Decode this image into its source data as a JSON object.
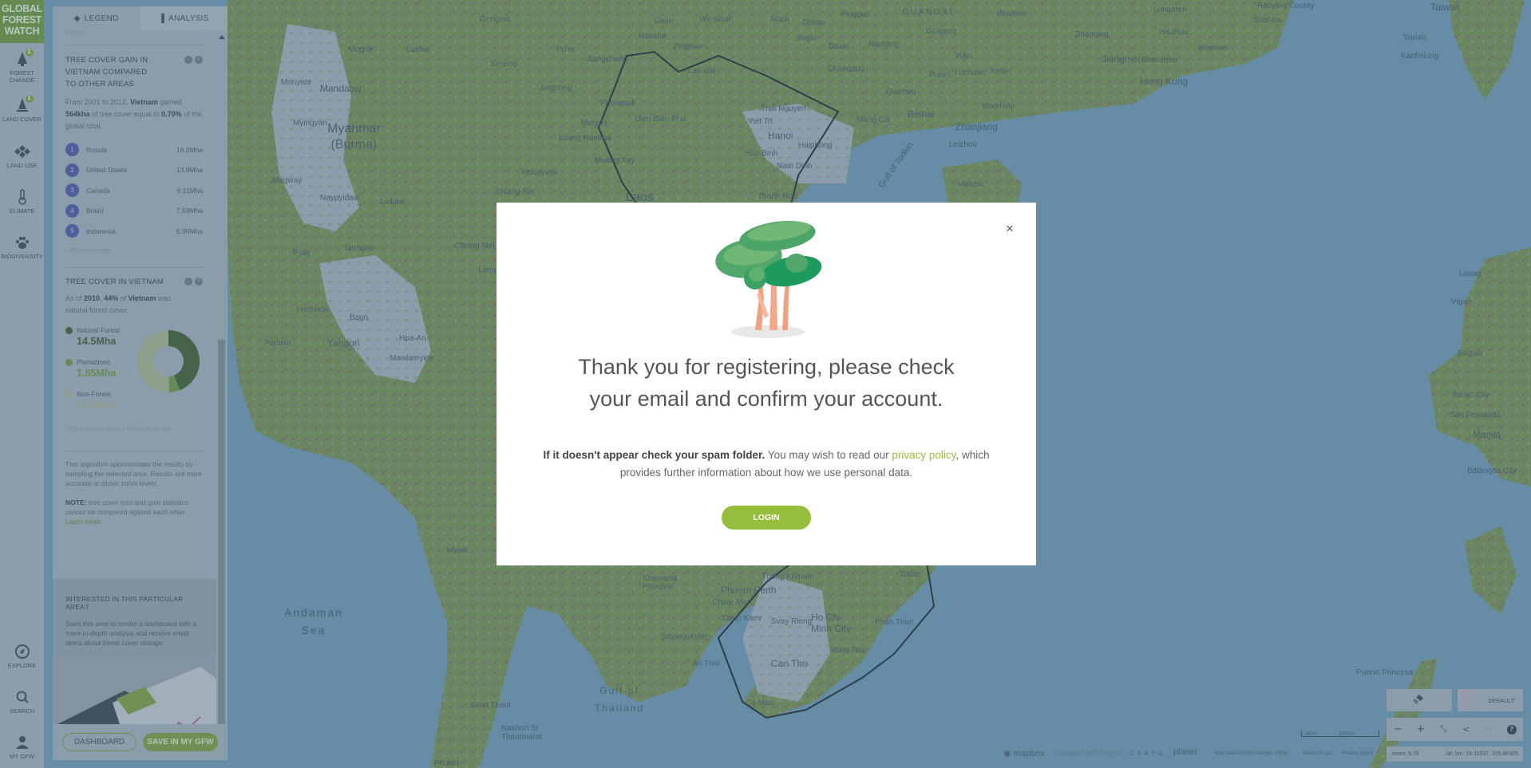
{
  "app": {
    "logo_lines": [
      "GLOBAL",
      "FOREST",
      "WATCH"
    ],
    "brand_color": "#6d9a3c",
    "accent_color": "#97bd3d"
  },
  "nav": {
    "items": [
      {
        "label": "FOREST\nCHANGE",
        "icon": "tree-icon",
        "badge": "2"
      },
      {
        "label": "LAND COVER",
        "icon": "pine-tree-icon",
        "badge": "1"
      },
      {
        "label": "LAND USE",
        "icon": "diamond-grid-icon"
      },
      {
        "label": "CLIMATE",
        "icon": "thermometer-icon"
      },
      {
        "label": "BIODIVERSITY",
        "icon": "paw-icon"
      }
    ],
    "bottom_items": [
      {
        "label": "EXPLORE",
        "icon": "compass-icon"
      },
      {
        "label": "SEARCH",
        "icon": "search-icon"
      },
      {
        "label": "MY GFW",
        "icon": "user-icon"
      }
    ]
  },
  "panel": {
    "tabs": [
      {
        "label": "LEGEND",
        "icon": "layers-icon",
        "active": false
      },
      {
        "label": "ANALYSIS",
        "icon": "bar-chart-icon",
        "active": true
      }
    ],
    "cut_text": "account",
    "gain_widget": {
      "title": "TREE COVER GAIN IN VIETNAM COMPARED TO OTHER AREAS",
      "sentence_prefix": "From 2001 to 2012, ",
      "country": "Vietnam",
      "sentence_mid": " gained ",
      "amount": "564kha",
      "sentence_mid2": " of tree cover equal to ",
      "percent": "0.70%",
      "sentence_suffix": " of the global total.",
      "ranking": [
        {
          "rank": "1",
          "name": "Russia",
          "value": "16.2Mha"
        },
        {
          "rank": "2",
          "name": "United States",
          "value": "13.8Mha"
        },
        {
          "rank": "3",
          "name": "Canada",
          "value": "9.11Mha"
        },
        {
          "rank": "4",
          "name": "Brazil",
          "value": "7.59Mha"
        },
        {
          "rank": "5",
          "name": "Indonesia",
          "value": "6.96Mha"
        }
      ],
      "note": ">50% tree canopy"
    },
    "cover_widget": {
      "title": "TREE COVER IN VIETNAM",
      "sentence_prefix": "As of ",
      "year": "2010",
      "sentence_comma": ", ",
      "percent": "44%",
      "sentence_of": " of ",
      "country": "Vietnam",
      "sentence_suffix": " was natural forest cover.",
      "legend": [
        {
          "name": "Natural Forest",
          "value": "14.5Mha",
          "color": "#3e5f2e"
        },
        {
          "name": "Plantations",
          "value": "1.85Mha",
          "color": "#6f9a45"
        },
        {
          "name": "Non-Forest",
          "value": "16.6Mha",
          "color": "#a9b58e"
        }
      ],
      "note": "2010 tree cover extent | >30% tree canopy"
    },
    "disclaimer": "This algorithm approximates the results by sampling the selected area. Results are more accurate at closer zoom levels.",
    "note_label": "NOTE:",
    "note_text": " tree cover loss and gain statistics cannot be compared against each other. ",
    "learn_more": "Learn more.",
    "cta": {
      "title": "INTERESTED IN THIS PARTICULAR AREA?",
      "text": "Save this area to create a dashboard with a more in-depth analysis and receive email alerts about forest cover change."
    },
    "buttons": {
      "dashboard": "DASHBOARD",
      "save": "SAVE IN MY GFW"
    }
  },
  "chart_data": {
    "type": "pie",
    "title": "TREE COVER IN VIETNAM",
    "categories": [
      "Natural Forest",
      "Plantations",
      "Non-Forest"
    ],
    "values": [
      14.5,
      1.85,
      16.6
    ],
    "unit": "Mha",
    "colors": [
      "#3e5f2e",
      "#6f9a45",
      "#a9b58e"
    ],
    "donut": true
  },
  "modal": {
    "title_line1": "Thank you for registering, please check",
    "title_line2": "your email and confirm your account.",
    "body_bold": "If it doesn't appear check your spam folder.",
    "body_text1": " You may wish to read our ",
    "privacy_link": "privacy policy",
    "body_text2": ", which provides further information about how we use personal data.",
    "login_button": "LOGIN",
    "close_icon": "close-icon"
  },
  "map": {
    "basemap_label": "DEFAULT",
    "zoom_readout": "zoom: 5.76",
    "latlon_readout": "lat, lon: 16.11537, 105.80305",
    "scale_labels": [
      "50mi",
      "100km"
    ],
    "attributions": [
      "mapbox",
      "Google Earth Engine",
      "CARTO",
      "planet",
      "Map data ©2018 Google, INEGI",
      "Terms of use",
      "Privacy policy"
    ],
    "labels": {
      "countries": [
        "Myanmar\n(Burma)",
        "Laos"
      ],
      "seas": [
        "Andaman\nSea",
        "Gulf of\nThailand",
        "Gulf of Tonkin"
      ],
      "regions": [
        "GUANGXI"
      ],
      "cities": [
        "Monywa",
        "Mandalay",
        "Myingyan",
        "Magway",
        "Naypyidaw",
        "Loikaw",
        "Mogok",
        "Lashio",
        "Gengma",
        "Ximeng",
        "Pu'er",
        "Jiangcheng",
        "Jinghong",
        "Phongsali",
        "Mengla",
        "Luang Namtha",
        "Muang Xay",
        "Houayxay",
        "Chiang Rai",
        "Chiang Mai",
        "Lampang",
        "Taungoo",
        "Pyay",
        "Hinthada",
        "Bago",
        "Yangon",
        "Pathein",
        "Hpa-An",
        "Mawlamyine",
        "Myeik",
        "Surat Thani",
        "Nakhon Si Thammarat",
        "Phuket",
        "Gejiu",
        "Wenshan",
        "Nansha",
        "Pingbian",
        "Lao Cai",
        "Dien Bien Phu",
        "Viet Tri",
        "Thai Nguyen",
        "Hanoi",
        "Haiphong",
        "Hoa Binh",
        "Nam Dinh",
        "Thanh Hoa",
        "Napo",
        "Debao",
        "Jingxi",
        "Daxin",
        "Pingguo",
        "Chongzuo",
        "Nanning",
        "Guigang",
        "Wuzhou",
        "Yulin",
        "Pubei",
        "Luchuan",
        "Xinyi",
        "Qinzhou",
        "Beihai",
        "Mong Cai",
        "Maoming",
        "Zhanjiang",
        "Leizhou",
        "Haikou",
        "Zhaoqing",
        "Jiangmen",
        "Shenzhen",
        "Hong Kong",
        "Huizhou",
        "Shanwei",
        "Longmen",
        "Shantou",
        "Raoping County",
        "Taiwan",
        "Tainan",
        "Kaohsiung",
        "Laoag",
        "Vigan",
        "Baguio",
        "Tarlac City",
        "San Fernando",
        "Manila",
        "Batangas City",
        "Puerto Princesa",
        "Khemarat Phoumin",
        "Phnom Penh",
        "Chbar Mon",
        "Doun Kaev",
        "Svay Rieng",
        "Tbong Khmum",
        "Ho Chi Minh City",
        "Phan Thiet",
        "Dalat",
        "Vung Tau",
        "Can Tho",
        "Ca Mau",
        "Sihanoukville",
        "An Thoi"
      ]
    }
  }
}
